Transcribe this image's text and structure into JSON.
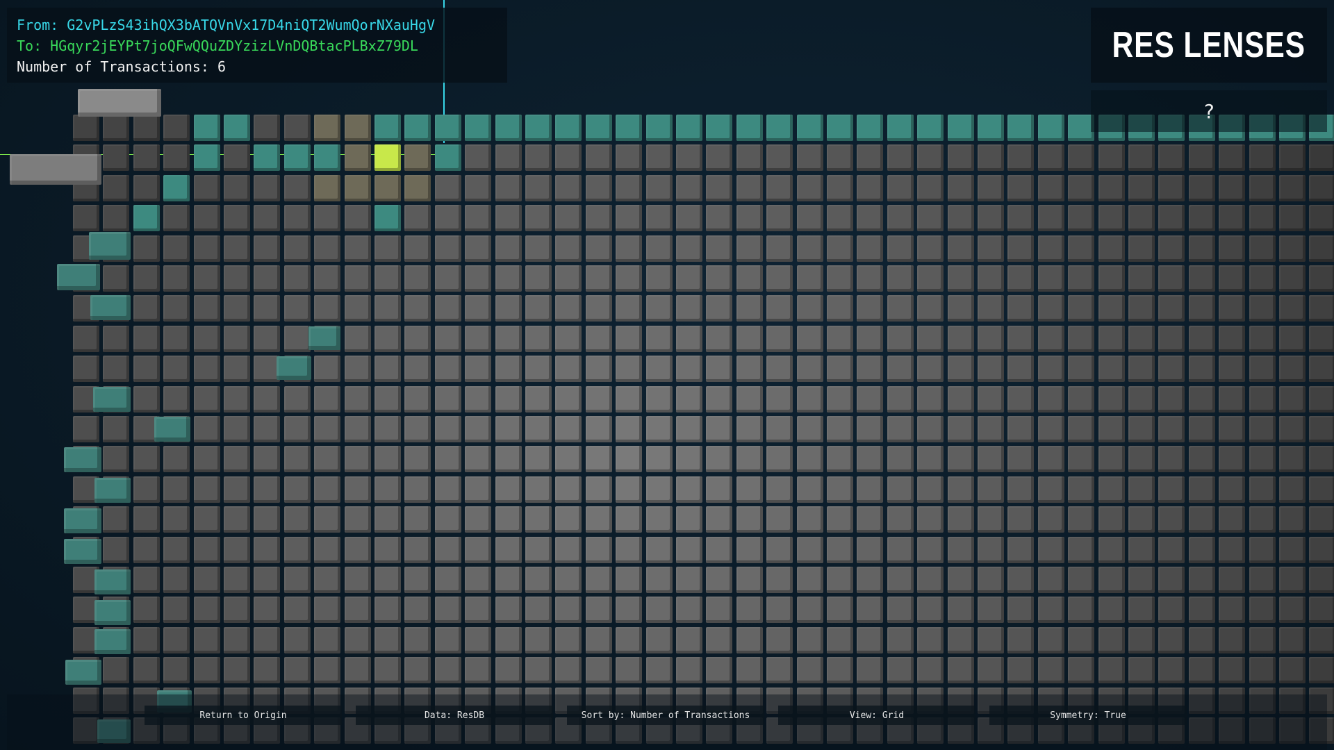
{
  "info": {
    "from_label": "From: G2vPLzS43ihQX3bATQVnVx17D4niQT2WumQorNXauHgV",
    "to_label": "To: HGqyr2jEYPt7joQFwQQuZDYzizLVnDQBtacPLBxZ79DL",
    "count_label": "Number of Transactions: 6"
  },
  "brand": {
    "title": "RES LENSES"
  },
  "help": {
    "label": "?"
  },
  "toolbar": {
    "items": [
      {
        "label": "Return to Origin"
      },
      {
        "label": "Data: ResDB"
      },
      {
        "label": "Sort by: Number of Transactions"
      },
      {
        "label": "View: Grid"
      },
      {
        "label": "Symmetry: True"
      }
    ]
  },
  "colors": {
    "from_text": "#38d8e8",
    "to_text": "#39d95a",
    "highlight": "#c8e84a",
    "teal_cell": "#3c8c82",
    "base_cell": "#3a3a3a"
  }
}
